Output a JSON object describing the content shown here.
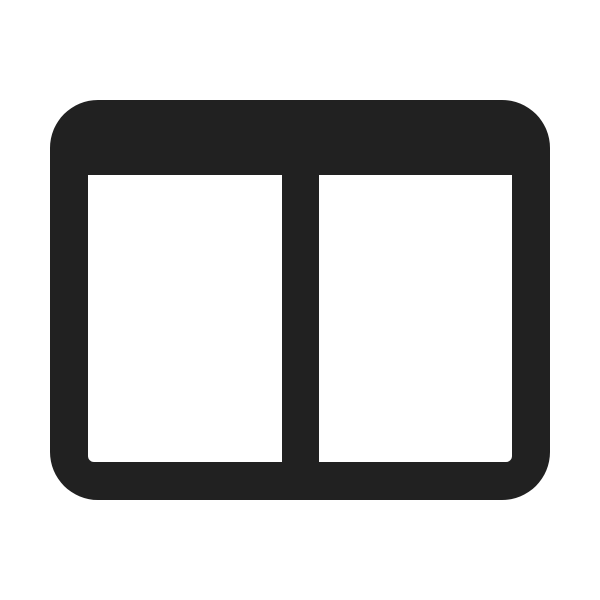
{
  "icon": {
    "name": "split-view-window-icon",
    "color": "#212121",
    "background": "#ffffff"
  }
}
